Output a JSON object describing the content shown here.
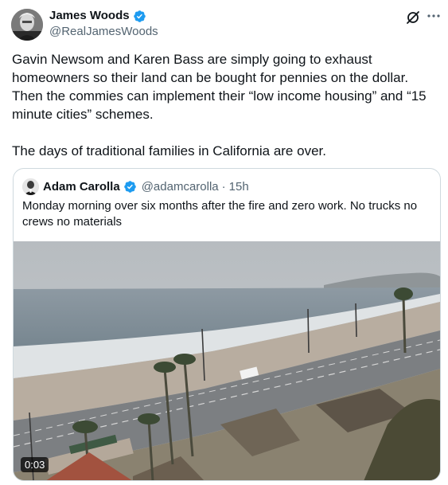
{
  "author": {
    "display_name": "James Woods",
    "handle": "@RealJamesWoods",
    "verified": true,
    "badge_color": "#1d9bf0"
  },
  "tweet": {
    "text": "Gavin Newsom and Karen Bass are simply going to exhaust homeowners so their land can be bought for pennies on the dollar. Then the commies can implement their “low income housing” and “15 minute cities” schemes.\n\nThe days of traditional families in California are over."
  },
  "quoted": {
    "display_name": "Adam Carolla",
    "handle": "@adamcarolla",
    "separator": "·",
    "time": "15h",
    "verified": true,
    "text": "Monday morning over six months after the fire and zero work. No trucks no crews no materials",
    "video": {
      "duration": "0:03"
    }
  },
  "icons": {
    "grok": "grok-icon",
    "more": "more-icon",
    "verified": "verified-badge-icon"
  },
  "colors": {
    "text": "#0f1419",
    "secondary_text": "#536471",
    "border": "#cfd9de"
  }
}
